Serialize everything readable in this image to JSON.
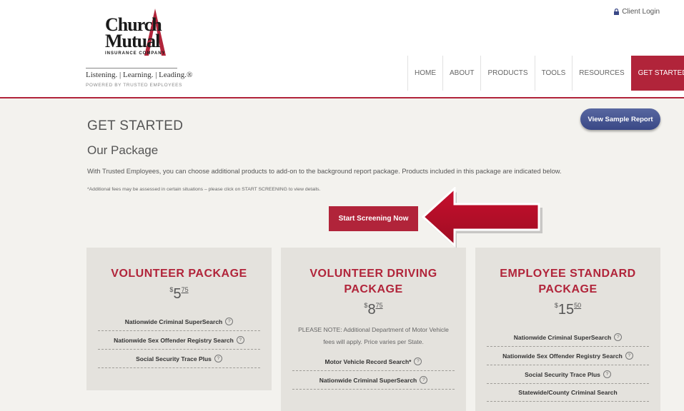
{
  "header": {
    "logo": {
      "line1": "Church",
      "line2": "Mutual",
      "company": "INSURANCE COMPANY",
      "tagline": "Listening. | Learning. | Leading.®",
      "powered_by": "POWERED BY TRUSTED EMPLOYEES"
    },
    "client_login": "Client Login",
    "nav": [
      "HOME",
      "ABOUT",
      "PRODUCTS",
      "TOOLS",
      "RESOURCES",
      "GET STARTED"
    ],
    "active_nav": "GET STARTED"
  },
  "main": {
    "page_title": "GET STARTED",
    "section_title": "Our Package",
    "intro": "With Trusted Employees, you can choose additional products to add-on to the background report package. Products included in this package are indicated below.",
    "note": "*Additional fees may be assessed in certain situations – please click on START SCREENING to view details.",
    "view_sample_label": "View Sample Report",
    "start_label": "Start Screening Now"
  },
  "packages": [
    {
      "title": "VOLUNTEER PACKAGE",
      "currency": "$",
      "dollars": "5",
      "cents": "75",
      "note": "",
      "features": [
        "Nationwide Criminal SuperSearch",
        "Nationwide Sex Offender Registry Search",
        "Social Security Trace Plus"
      ]
    },
    {
      "title": "VOLUNTEER DRIVING PACKAGE",
      "currency": "$",
      "dollars": "8",
      "cents": "75",
      "note": "PLEASE NOTE: Additional Department of Motor Vehicle fees will apply. Price varies per State.",
      "features": [
        "Motor Vehicle Record Search*",
        "Nationwide Criminal SuperSearch"
      ]
    },
    {
      "title": "EMPLOYEE STANDARD PACKAGE",
      "currency": "$",
      "dollars": "15",
      "cents": "50",
      "note": "",
      "features": [
        "Nationwide Criminal SuperSearch",
        "Nationwide Sex Offender Registry Search",
        "Social Security Trace Plus",
        "Statewide/County Criminal Search"
      ]
    }
  ],
  "icons": {
    "lock": "lock-icon",
    "help": "question-icon",
    "arrow": "arrow-pointer"
  },
  "colors": {
    "brand_red": "#b1243a",
    "sample_blue": "#3a4886",
    "card_bg": "#e4e2dd",
    "page_bg": "#f3f2ee"
  }
}
